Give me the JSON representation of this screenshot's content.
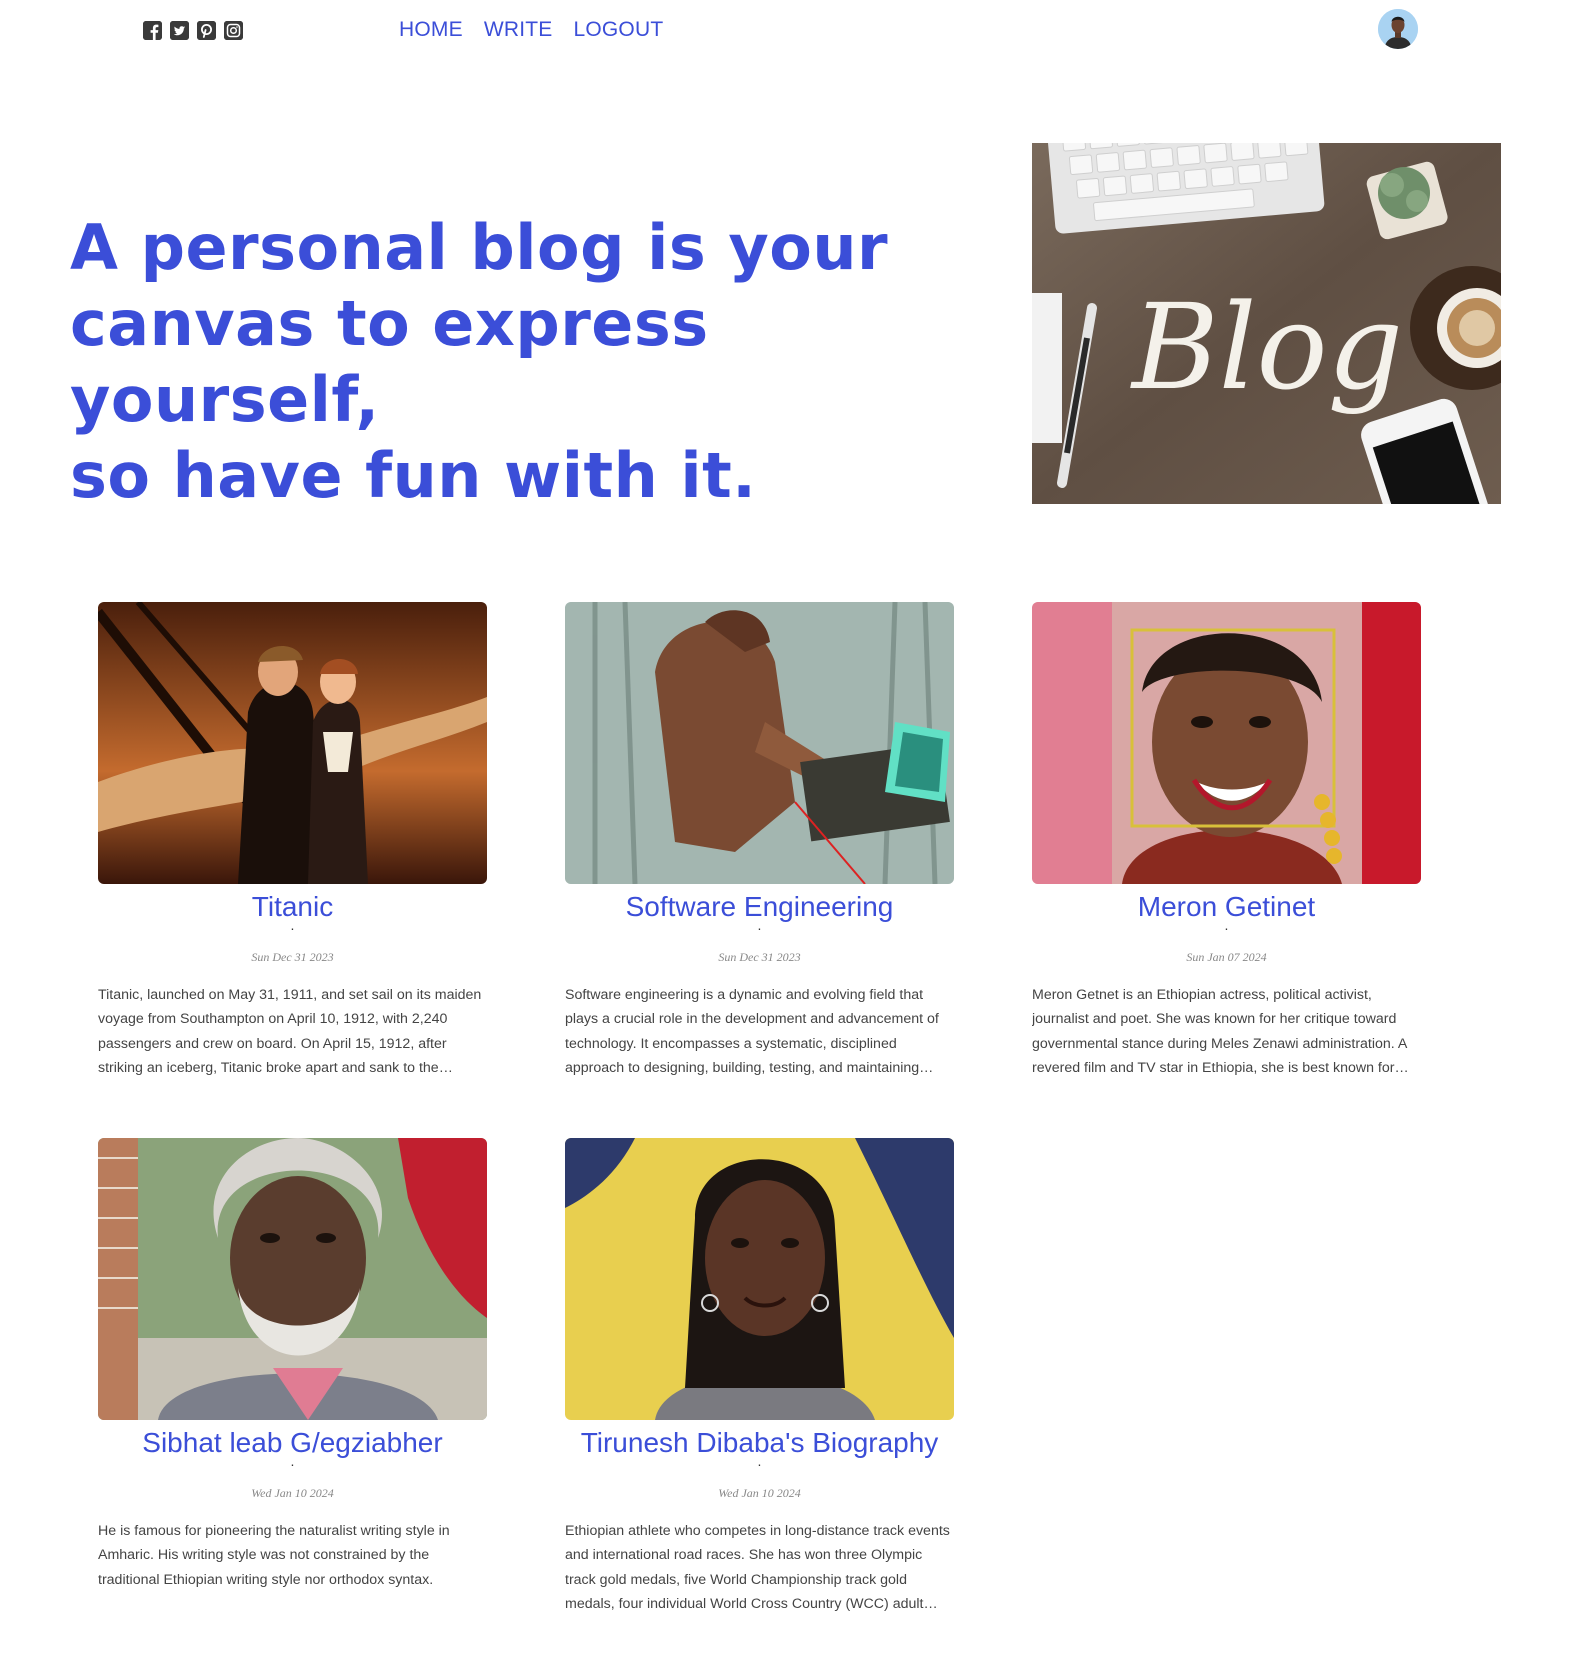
{
  "topbar": {
    "social": [
      {
        "icon": "facebook-square-icon"
      },
      {
        "icon": "twitter-square-icon"
      },
      {
        "icon": "pinterest-square-icon"
      },
      {
        "icon": "instagram-square-icon"
      }
    ],
    "nav": {
      "home": "HOME",
      "write": "WRITE",
      "logout": "LOGOUT"
    },
    "avatar": {
      "icon": "profile-avatar"
    }
  },
  "hero": {
    "line1": "A personal blog is your",
    "line2": "canvas to express yourself,",
    "line3": "so have fun with it.",
    "image": {
      "text": "Blog"
    }
  },
  "posts": [
    {
      "title": "Titanic",
      "dot": "·",
      "date": "Sun Dec 31 2023",
      "excerpt": "Titanic, launched on May 31, 1911, and set sail on its maiden voyage from Southampton on April 10, 1912, with 2,240 passengers and crew on board. On April 15, 1912, after striking an iceberg, Titanic broke apart and sank to the…"
    },
    {
      "title": "Software Engineering",
      "dot": "·",
      "date": "Sun Dec 31 2023",
      "excerpt": "Software engineering is a dynamic and evolving field that plays a crucial role in the development and advancement of technology. It encompasses a systematic, disciplined approach to designing, building, testing, and maintaining…"
    },
    {
      "title": "Meron Getinet",
      "dot": "·",
      "date": "Sun Jan 07 2024",
      "excerpt": "Meron Getnet is an Ethiopian actress, political activist, journalist and poet. She was known for her critique toward governmental stance during Meles Zenawi administration. A revered film and TV star in Ethiopia, she is best known for…"
    },
    {
      "title": "Sibhat leab G/egziabher",
      "dot": "·",
      "date": "Wed Jan 10 2024",
      "excerpt": "He is famous for pioneering the naturalist writing style in Amharic. His writing style was not constrained by the traditional Ethiopian writing style nor orthodox syntax."
    },
    {
      "title": "Tirunesh Dibaba's Biography",
      "dot": "·",
      "date": "Wed Jan 10 2024",
      "excerpt": "Ethiopian athlete who competes in long-distance track events and international road races. She has won three Olympic track gold medals, five World Championship track gold medals, four individual World Cross Country (WCC) adult…"
    }
  ]
}
